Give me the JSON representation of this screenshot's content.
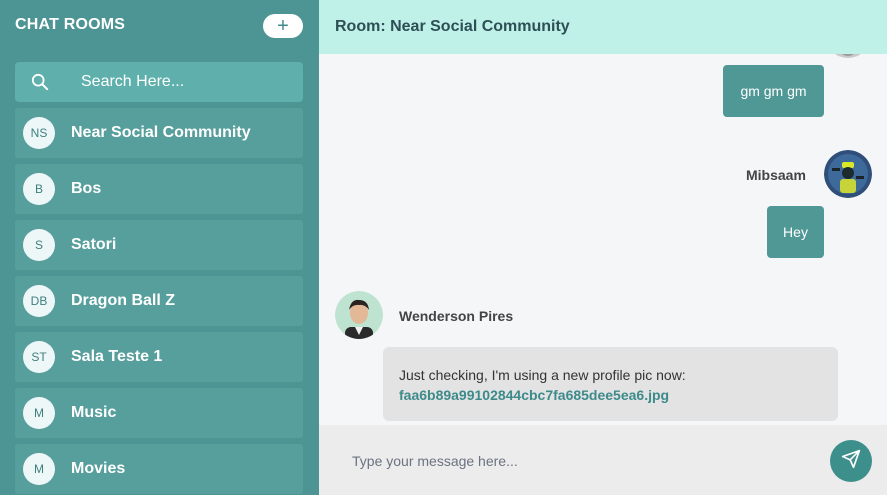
{
  "sidebar": {
    "title": "CHAT ROOMS",
    "add_label": "+",
    "search": {
      "placeholder": "Search Here..."
    },
    "rooms": [
      {
        "initials": "NS",
        "name": "Near Social Community"
      },
      {
        "initials": "B",
        "name": "Bos"
      },
      {
        "initials": "S",
        "name": "Satori"
      },
      {
        "initials": "DB",
        "name": "Dragon Ball Z"
      },
      {
        "initials": "ST",
        "name": "Sala Teste 1"
      },
      {
        "initials": "M",
        "name": "Music"
      },
      {
        "initials": "M",
        "name": "Movies"
      }
    ]
  },
  "header": {
    "title": "Room: Near Social Community"
  },
  "messages": [
    {
      "text": "gm gm gm"
    },
    {
      "sender": "Mibsaam",
      "text": "Hey"
    },
    {
      "sender": "Wenderson Pires",
      "text": "Just checking, I'm using a new profile pic now:",
      "link": "faa6b89a99102844cbc7fa685dee5ea6.jpg"
    }
  ],
  "composer": {
    "placeholder": "Type your message here..."
  },
  "colors": {
    "sidebar": "#4d9594",
    "room": "#579f9d",
    "header": "#bff1e9",
    "bubble": "#4f9896",
    "send": "#3d8f8c"
  },
  "icons": {
    "search": "search-icon",
    "send": "send-icon",
    "add": "plus-icon"
  }
}
